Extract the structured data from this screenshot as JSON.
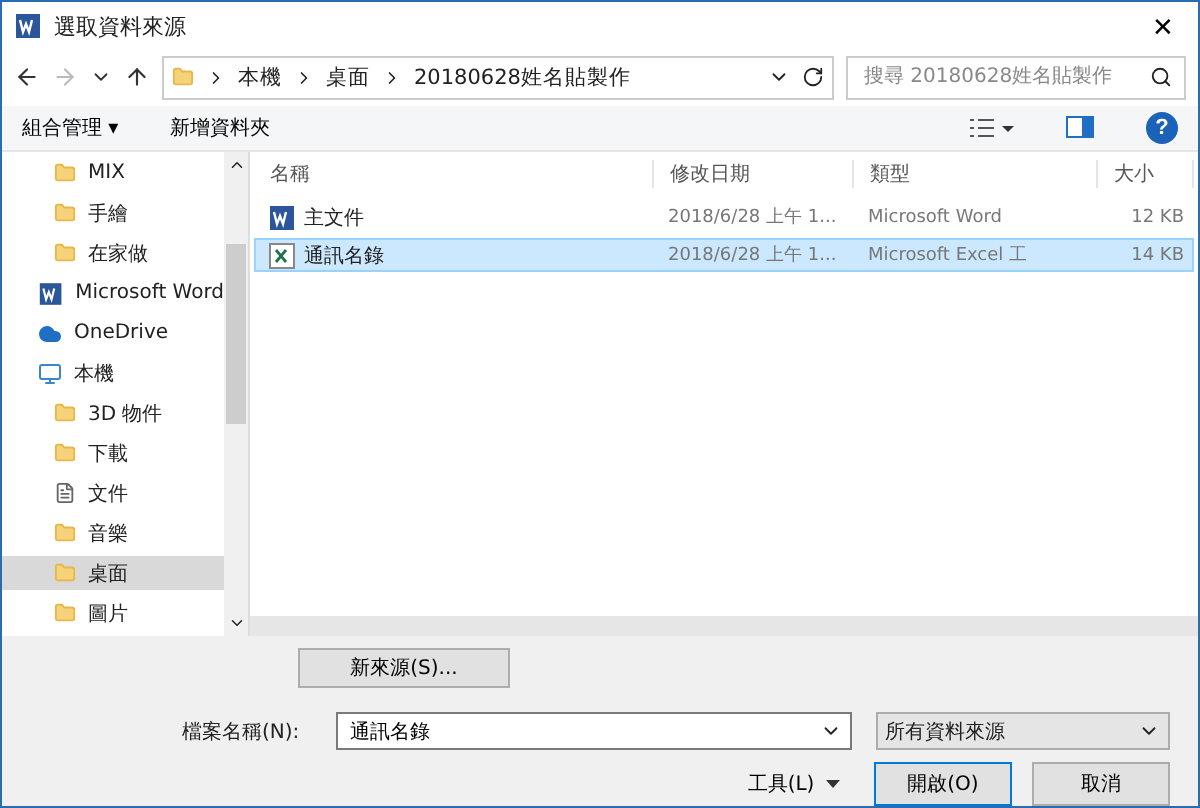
{
  "window": {
    "title": "選取資料來源",
    "close": "✕"
  },
  "address": {
    "path": [
      "本機",
      "桌面",
      "20180628姓名貼製作"
    ],
    "search_placeholder": "搜尋 20180628姓名貼製作"
  },
  "toolbar": {
    "organize": "組合管理 ▾",
    "new_folder": "新增資料夾",
    "help": "?"
  },
  "sidebar": {
    "items": [
      {
        "label": "MIX",
        "kind": "folder",
        "selected": false
      },
      {
        "label": "手繪",
        "kind": "folder",
        "selected": false
      },
      {
        "label": "在家做",
        "kind": "folder",
        "selected": false
      },
      {
        "label": "Microsoft Word",
        "kind": "word",
        "selected": false
      },
      {
        "label": "OneDrive",
        "kind": "cloud",
        "selected": false
      },
      {
        "label": "本機",
        "kind": "pc",
        "selected": false,
        "children": [
          {
            "label": "3D 物件",
            "kind": "folder",
            "selected": false
          },
          {
            "label": "下載",
            "kind": "folder",
            "selected": false
          },
          {
            "label": "文件",
            "kind": "doc",
            "selected": false
          },
          {
            "label": "音樂",
            "kind": "folder",
            "selected": false
          },
          {
            "label": "桌面",
            "kind": "folder",
            "selected": true
          },
          {
            "label": "圖片",
            "kind": "folder",
            "selected": false
          }
        ]
      }
    ]
  },
  "table": {
    "columns": [
      "名稱",
      "修改日期",
      "類型",
      "大小"
    ],
    "rows": [
      {
        "name": "主文件",
        "date": "2018/6/28 上午 1...",
        "type": "Microsoft Word",
        "size": "12 KB",
        "kind": "word",
        "selected": false
      },
      {
        "name": "通訊名錄",
        "date": "2018/6/28 上午 1...",
        "type": "Microsoft Excel 工",
        "size": "14 KB",
        "kind": "excel",
        "selected": true
      }
    ]
  },
  "new_source_button": "新來源(S)...",
  "filename": {
    "label": "檔案名稱(N):",
    "value": "通訊名錄"
  },
  "filter": {
    "value": "所有資料來源"
  },
  "buttons": [
    {
      "label": "工具(L)",
      "kind": "menu"
    },
    {
      "label": "開啟(O)",
      "kind": "primary"
    },
    {
      "label": "取消",
      "kind": "plain"
    }
  ]
}
